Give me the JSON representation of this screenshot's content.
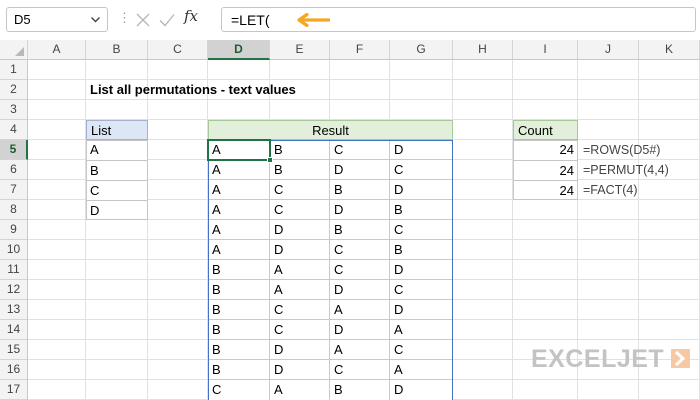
{
  "formula_bar": {
    "name_box": "D5",
    "separator": "⋮",
    "fx_label": "fx",
    "formula": "=LET("
  },
  "columns": [
    "A",
    "B",
    "C",
    "D",
    "E",
    "F",
    "G",
    "H",
    "I",
    "J",
    "K"
  ],
  "rows": [
    "1",
    "2",
    "3",
    "4",
    "5",
    "6",
    "7",
    "8",
    "9",
    "10",
    "11",
    "12",
    "13",
    "14",
    "15",
    "16",
    "17"
  ],
  "selected_cell": {
    "column": "D",
    "row": "5"
  },
  "sheet": {
    "title": "List all permutations - text values",
    "list_header": "List",
    "list_values": [
      "A",
      "B",
      "C",
      "D"
    ],
    "result_header": "Result",
    "result_rows": [
      [
        "A",
        "B",
        "C",
        "D"
      ],
      [
        "A",
        "B",
        "D",
        "C"
      ],
      [
        "A",
        "C",
        "B",
        "D"
      ],
      [
        "A",
        "C",
        "D",
        "B"
      ],
      [
        "A",
        "D",
        "B",
        "C"
      ],
      [
        "A",
        "D",
        "C",
        "B"
      ],
      [
        "B",
        "A",
        "C",
        "D"
      ],
      [
        "B",
        "A",
        "D",
        "C"
      ],
      [
        "B",
        "C",
        "A",
        "D"
      ],
      [
        "B",
        "C",
        "D",
        "A"
      ],
      [
        "B",
        "D",
        "A",
        "C"
      ],
      [
        "B",
        "D",
        "C",
        "A"
      ],
      [
        "C",
        "A",
        "B",
        "D"
      ]
    ],
    "count_header": "Count",
    "counts": [
      "24",
      "24",
      "24"
    ],
    "count_formulas": [
      "=ROWS(D5#)",
      "=PERMUT(4,4)",
      "=FACT(4)"
    ]
  },
  "logo": {
    "text": "EXCELJET"
  },
  "colors": {
    "accent_green": "#217346",
    "arrow_orange": "#f5a623",
    "list_header_fill": "#dce6f4",
    "result_header_fill": "#e2efda",
    "spill_border": "#4472c4"
  }
}
